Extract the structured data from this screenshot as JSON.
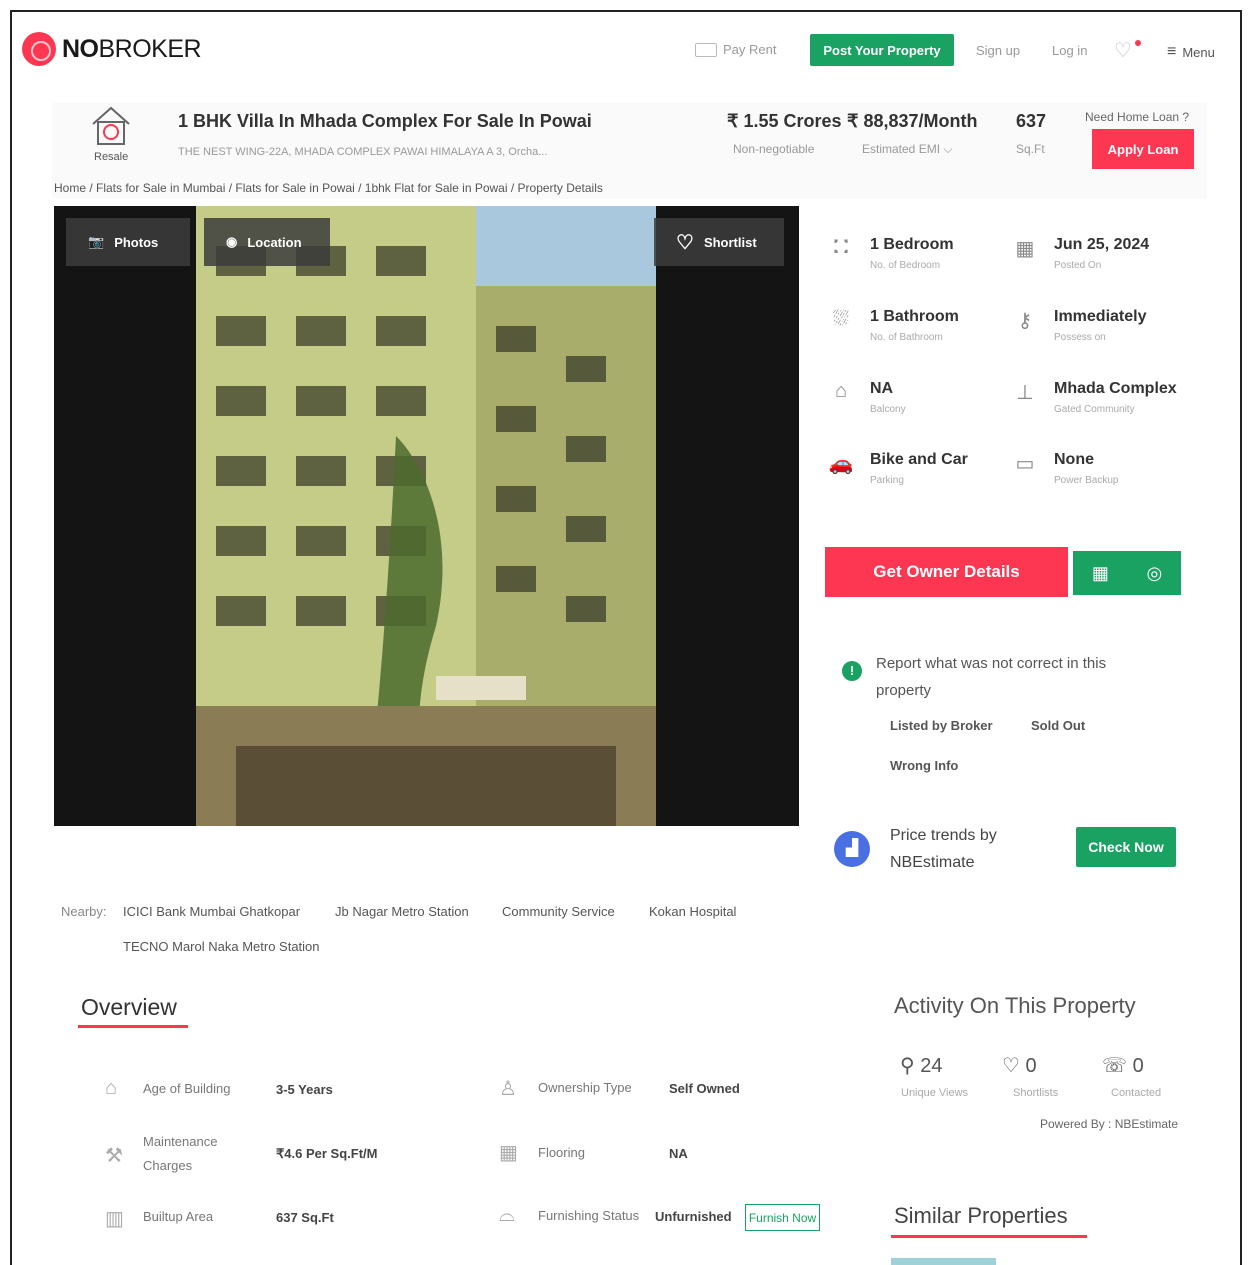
{
  "header": {
    "logo": {
      "bold": "NO",
      "regular": "BROKER"
    },
    "nav": {
      "pay_rent": "Pay Rent",
      "post_property": "Post Your Property",
      "sign_up": "Sign up",
      "log_in": "Log in",
      "menu": "Menu"
    }
  },
  "property": {
    "tag": "Resale",
    "title": "1 BHK Villa In Mhada Complex For Sale In Powai",
    "address": "THE NEST WING-22A, MHADA COMPLEX PAWAI HIMALAYA A 3, Orcha...",
    "price": "₹ 1.55 Crores",
    "price_note": "Non-negotiable",
    "emi": "₹ 88,837/Month",
    "emi_note": "Estimated EMI ⌵",
    "area": "637",
    "area_unit": "Sq.Ft",
    "home_loan_q": "Need Home Loan ?",
    "apply_loan": "Apply Loan"
  },
  "breadcrumb": "Home / Flats for Sale in Mumbai / Flats for Sale in Powai / 1bhk Flat for Sale in Powai / Property Details",
  "photo_bar": {
    "photos": "Photos",
    "location": "Location",
    "shortlist": "Shortlist"
  },
  "specs": [
    {
      "value": "1 Bedroom",
      "label": "No. of Bedroom",
      "icon": "bed-icon"
    },
    {
      "value": "Jun 25, 2024",
      "label": "Posted On",
      "icon": "calendar-icon"
    },
    {
      "value": "1 Bathroom",
      "label": "No. of Bathroom",
      "icon": "bath-icon"
    },
    {
      "value": "Immediately",
      "label": "Possess on",
      "icon": "key-icon"
    },
    {
      "value": "NA",
      "label": "Balcony",
      "icon": "balcony-icon"
    },
    {
      "value": "Mhada Complex",
      "label": "Gated Community",
      "icon": "gate-icon"
    },
    {
      "value": "Bike and Car",
      "label": "Parking",
      "icon": "car-icon"
    },
    {
      "value": "None",
      "label": "Power Backup",
      "icon": "battery-icon"
    }
  ],
  "cta": {
    "owner_details": "Get Owner Details"
  },
  "report": {
    "text": "Report what was not correct in this property",
    "options": [
      "Listed by Broker",
      "Sold Out",
      "Wrong Info"
    ]
  },
  "price_trends": {
    "text": "Price trends by NBEstimate",
    "button": "Check Now"
  },
  "nearby": {
    "label": "Nearby:",
    "places": [
      "ICICI Bank Mumbai Ghatkopar",
      "Jb Nagar Metro Station",
      "Community Service",
      "Kokan Hospital",
      "TECNO Marol Naka Metro Station"
    ]
  },
  "overview": {
    "title": "Overview",
    "rows": [
      {
        "label": "Age of Building",
        "value": "3-5 Years",
        "label2": "Ownership Type",
        "value2": "Self Owned"
      },
      {
        "label": "Maintenance Charges",
        "value": "₹4.6 Per Sq.Ft/M",
        "label2": "Flooring",
        "value2": "NA"
      },
      {
        "label": "Builtup Area",
        "value": "637 Sq.Ft",
        "label2": "Furnishing Status",
        "value2": "Unfurnished"
      }
    ],
    "furnish_now": "Furnish Now"
  },
  "activity": {
    "title": "Activity On This Property",
    "views": "24",
    "views_label": "Unique Views",
    "shortlists": "0",
    "shortlists_label": "Shortlists",
    "contacted": "0",
    "contacted_label": "Contacted",
    "powered": "Powered By : NBEstimate"
  },
  "similar": {
    "title": "Similar Properties"
  },
  "colors": {
    "brand_red": "#fd3752",
    "brand_green": "#1aa262",
    "trend_blue": "#4a6fe3"
  }
}
